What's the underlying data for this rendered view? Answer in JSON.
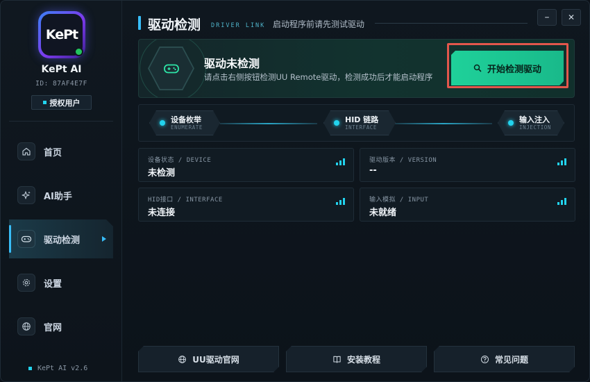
{
  "app": {
    "logo_text": "KePt",
    "name": "KePt AI",
    "id": "ID: 87AF4E7F",
    "auth_label": "授权用户",
    "version": "KePt AI v2.6"
  },
  "sidebar": {
    "items": [
      {
        "label": "首页",
        "icon": "home-icon"
      },
      {
        "label": "AI助手",
        "icon": "sparkle-icon"
      },
      {
        "label": "驱动检测",
        "icon": "gamepad-icon",
        "active": true
      },
      {
        "label": "设置",
        "icon": "gear-icon"
      },
      {
        "label": "官网",
        "icon": "globe-icon"
      }
    ]
  },
  "header": {
    "title": "驱动检测",
    "subtitle_en": "DRIVER LINK",
    "description": "启动程序前请先测试驱动",
    "minimize": "–",
    "close": "✕"
  },
  "status": {
    "title": "驱动未检测",
    "description": "请点击右侧按钮检测UU Remote驱动，检测成功后才能启动程序",
    "button_label": "开始检测驱动"
  },
  "steps": [
    {
      "cn": "设备枚举",
      "en": "ENUMERATE"
    },
    {
      "cn": "HID 链路",
      "en": "INTERFACE"
    },
    {
      "cn": "输入注入",
      "en": "INJECTION"
    }
  ],
  "info": [
    {
      "label": "设备状态 / DEVICE",
      "value": "未检测"
    },
    {
      "label": "驱动版本 / VERSION",
      "value": "--"
    },
    {
      "label": "HID接口 / INTERFACE",
      "value": "未连接"
    },
    {
      "label": "输入模拟 / INPUT",
      "value": "未就绪"
    }
  ],
  "footer": {
    "buttons": [
      {
        "label": "UU驱动官网",
        "icon": "globe-icon"
      },
      {
        "label": "安装教程",
        "icon": "book-icon"
      },
      {
        "label": "常见问题",
        "icon": "question-icon"
      }
    ]
  },
  "colors": {
    "accent": "#22d3ee",
    "primary_button": "#1fd19a",
    "highlight": "#e2574c",
    "background": "#0f171f"
  }
}
